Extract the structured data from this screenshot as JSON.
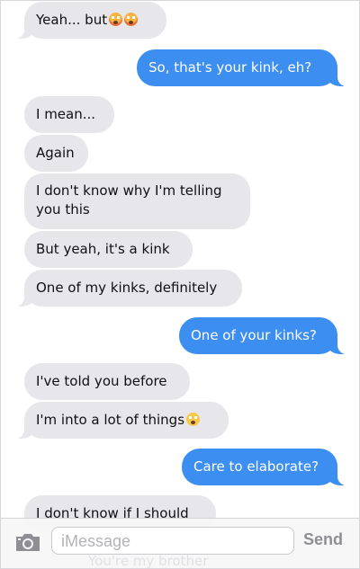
{
  "messages": [
    {
      "text": "Yeah... but",
      "direction": "in",
      "emoji": [
        "face-screaming-icon",
        "face-screaming-icon"
      ]
    },
    {
      "text": "So, that's your kink, eh?",
      "direction": "out"
    },
    {
      "text": "I mean...",
      "direction": "in"
    },
    {
      "text": "Again",
      "direction": "in"
    },
    {
      "line1": "I don't know why I'm telling",
      "line2": "you this",
      "direction": "in"
    },
    {
      "text": "But yeah, it's a kink",
      "direction": "in"
    },
    {
      "text": "One of my kinks, definitely",
      "direction": "in"
    },
    {
      "text": "One of your kinks?",
      "direction": "out"
    },
    {
      "text": "I've told you before",
      "direction": "in"
    },
    {
      "text": "I'm into a lot of things",
      "direction": "in",
      "emoji": [
        "flushed-face-icon"
      ]
    },
    {
      "text": "Care to elaborate?",
      "direction": "out"
    },
    {
      "text": "I don't know if I should",
      "direction": "in"
    }
  ],
  "composer": {
    "placeholder": "iMessage",
    "ghost_text": "You're my brother",
    "send_label": "Send"
  },
  "colors": {
    "incoming_bubble": "#e6e6eb",
    "outgoing_bubble": "#3d8ef1",
    "send_disabled": "#8e8e93"
  }
}
